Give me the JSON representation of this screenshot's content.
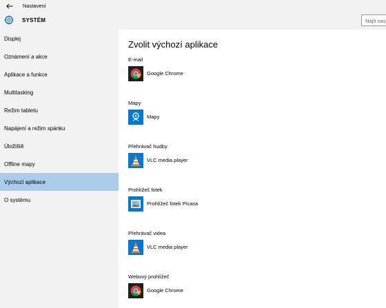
{
  "window": {
    "title": "Nastavení",
    "section_title": "SYSTÉM",
    "search_placeholder": "Najít nasta"
  },
  "sidebar": {
    "items": [
      {
        "label": "Displej"
      },
      {
        "label": "Oznámení a akce"
      },
      {
        "label": "Aplikace a funkce"
      },
      {
        "label": "Multitasking"
      },
      {
        "label": "Režim tabletu"
      },
      {
        "label": "Napájení a režim spánku"
      },
      {
        "label": "Úložiště"
      },
      {
        "label": "Offline mapy"
      },
      {
        "label": "Výchozí aplikace",
        "active": true
      },
      {
        "label": "O systému"
      }
    ]
  },
  "main": {
    "title": "Zvolit výchozí aplikace",
    "sections": [
      {
        "label": "E-mail",
        "app": "Google Chrome",
        "icon": "chrome-icon"
      },
      {
        "label": "Mapy",
        "app": "Mapy",
        "icon": "maps-icon"
      },
      {
        "label": "Přehrávač hudby",
        "app": "VLC media player",
        "icon": "vlc-icon"
      },
      {
        "label": "Prohlížeč fotek",
        "app": "Prohlížeč fotek Picasa",
        "icon": "picasa-icon"
      },
      {
        "label": "Přehrávač videa",
        "app": "VLC media player",
        "icon": "vlc-icon"
      },
      {
        "label": "Webový prohlížeč",
        "app": "Google Chrome",
        "icon": "chrome-icon"
      }
    ]
  },
  "colors": {
    "accent": "#0078d7",
    "active_item_bg": "#a9cdea",
    "sidebar_bg": "#f2f2f2"
  }
}
